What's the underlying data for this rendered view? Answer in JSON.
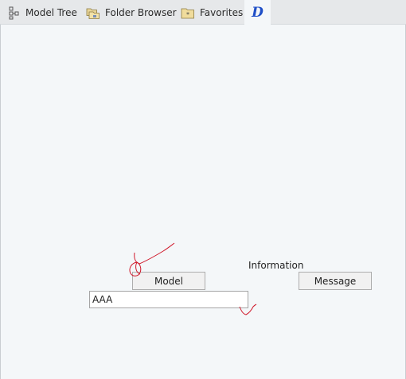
{
  "tabs": [
    {
      "label": "Model Tree",
      "icon": "model-tree-icon"
    },
    {
      "label": "Folder Browser",
      "icon": "folder-browser-icon"
    },
    {
      "label": "Favorites",
      "icon": "favorites-folder-icon"
    },
    {
      "label": "",
      "icon": "d-logo-icon",
      "glyph": "D",
      "active": true
    }
  ],
  "form": {
    "model_button_label": "Model",
    "information_label": "Information",
    "message_button_label": "Message",
    "text_value": "AAA"
  },
  "colors": {
    "annotation_stroke": "#d0192b",
    "tab_bar_bg": "#e6e8ea",
    "content_bg": "#f4f7f9",
    "logo_blue": "#1f4fc7"
  }
}
